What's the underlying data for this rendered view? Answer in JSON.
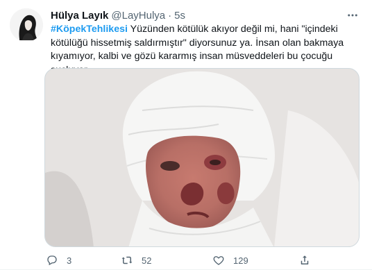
{
  "tweet": {
    "author": {
      "display_name": "Hülya Layık",
      "handle": "@LayHulya",
      "separator": "·",
      "time": "5s"
    },
    "text": {
      "hashtag": "#KöpekTehlikesi",
      "body": " Yüzünden kötülük akıyor değil mi, hani \"içindeki kötülüğü hissetmiş saldırmıştır\" diyorsunuz ya. İnsan olan bakmaya kıyamıyor, kalbi ve gözü kararmış insan müsveddeleri bu çocuğu suçluyor.."
    },
    "actions": {
      "reply": {
        "icon": "reply-icon",
        "count": "3"
      },
      "retweet": {
        "icon": "retweet-icon",
        "count": "52"
      },
      "like": {
        "icon": "heart-icon",
        "count": "129"
      },
      "share": {
        "icon": "share-icon"
      }
    },
    "colors": {
      "hashtag": "#1d9bf0",
      "muted": "#536471",
      "text": "#0f1419"
    }
  }
}
